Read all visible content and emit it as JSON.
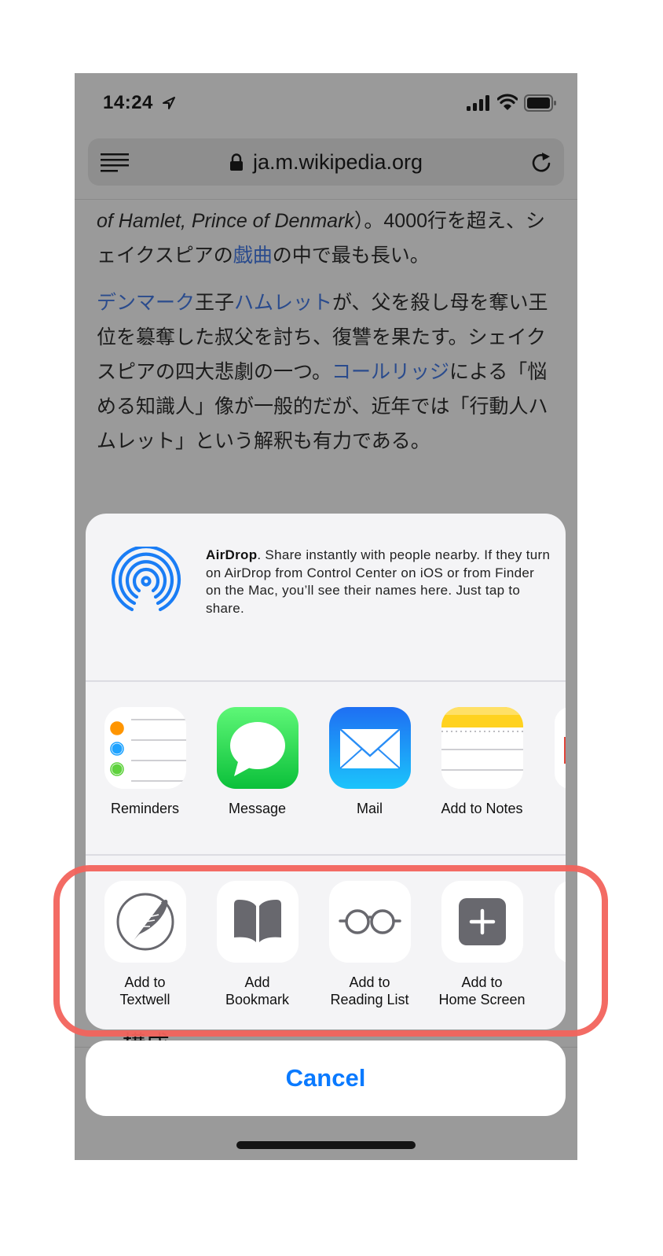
{
  "status_bar": {
    "time": "14:24",
    "icons": [
      "location-arrow-icon",
      "cellular-signal-icon",
      "wifi-icon",
      "battery-icon"
    ]
  },
  "browser": {
    "url": "ja.m.wikipedia.org",
    "icons": [
      "reader-menu-icon",
      "lock-icon",
      "reload-icon"
    ]
  },
  "article": {
    "p1": {
      "italic": "of Hamlet, Prince of Denmark",
      "t1": "）。4000行を超え、シェイクスピアの",
      "link1": "戯曲",
      "t2": "の中で最も長い。"
    },
    "p2": {
      "link1": "デンマーク",
      "t1": "王子",
      "link2": "ハムレット",
      "t2": "が、父を殺し母を奪い王位を簒奪した叔父を討ち、復讐を果たす。シェイクスピアの四大悲劇の一つ。",
      "link3": "コールリッジ",
      "t3": "による「悩める知識人」像が一般的だが、近年では「行動人ハムレット」という解釈も有力である。"
    },
    "section_heading_peek": "構成"
  },
  "share_sheet": {
    "airdrop": {
      "title": "AirDrop",
      "description": ". Share instantly with people nearby. If they turn on AirDrop from Control Center on iOS or from Finder on the Mac, you’ll see their names here. Just tap to share."
    },
    "apps": [
      {
        "label": "Reminders",
        "icon": "reminders-icon"
      },
      {
        "label": "Message",
        "icon": "messages-icon"
      },
      {
        "label": "Mail",
        "icon": "mail-icon"
      },
      {
        "label": "Add to Notes",
        "icon": "notes-icon"
      }
    ],
    "actions": [
      {
        "label": "Add to Textwell",
        "line1": "Add to",
        "line2": "Textwell",
        "icon": "textwell-quill-icon"
      },
      {
        "label": "Add Bookmark",
        "line1": "Add",
        "line2": "Bookmark",
        "icon": "bookmark-book-icon"
      },
      {
        "label": "Add to Reading List",
        "line1": "Add to",
        "line2": "Reading List",
        "icon": "reading-list-glasses-icon"
      },
      {
        "label": "Add to Home Screen",
        "line1": "Add to",
        "line2": "Home Screen",
        "icon": "add-to-home-screen-icon"
      }
    ],
    "cancel_label": "Cancel"
  },
  "colors": {
    "accent_blue": "#0a7aff",
    "link_blue": "#2a4b8d",
    "highlight_red": "#f2635c",
    "dim_overlay": "#9a9a9a"
  }
}
